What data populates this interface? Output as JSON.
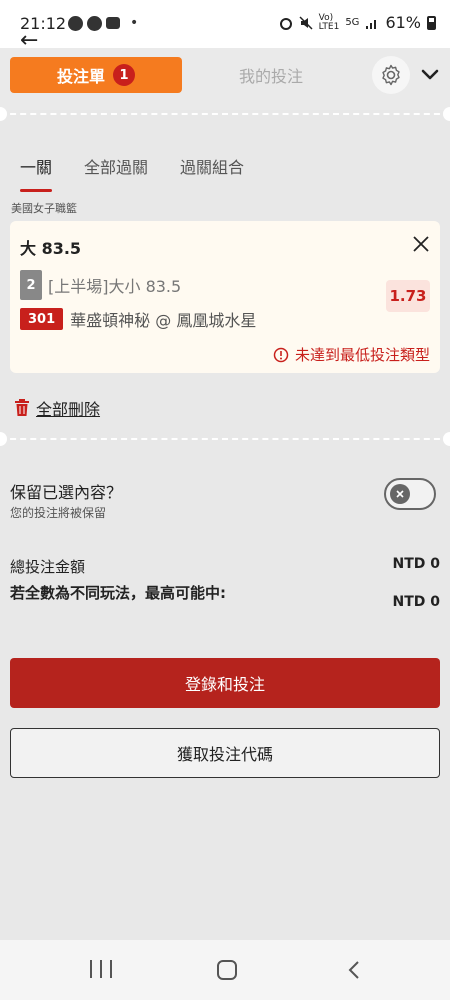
{
  "status_bar": {
    "time": "21:12",
    "battery": "61%",
    "network": "5G"
  },
  "header": {
    "betslip_tab": "投注單",
    "betslip_count": "1",
    "my_bets_tab": "我的投注",
    "gear_icon": "gear-icon",
    "chevron_icon": "chevron-down-icon"
  },
  "subtabs": [
    "一關",
    "全部過關",
    "過關組合"
  ],
  "league": "美國女子職籃",
  "bet": {
    "selection": "大 83.5",
    "market_num": "2",
    "market": "[上半場]大小 83.5",
    "match_num": "301",
    "match": "華盛頓神秘 @ 鳳凰城水星",
    "odds": "1.73",
    "warning": "未達到最低投注類型",
    "accent_color": "#c8201c"
  },
  "delete_all": "全部刪除",
  "keep": {
    "title": "保留已選內容？",
    "subtitle": "您的投注將被保留",
    "toggle_on": false
  },
  "totals": {
    "total_label": "總投注金額",
    "total_value": "NTD 0",
    "maxwin_label": "若全數為不同玩法，最高可能中:",
    "maxwin_value": "NTD 0"
  },
  "buttons": {
    "login_bet": "登錄和投注",
    "get_code": "獲取投注代碼"
  },
  "colors": {
    "orange_tab": "#f57b1f",
    "primary_red": "#b5231d"
  }
}
